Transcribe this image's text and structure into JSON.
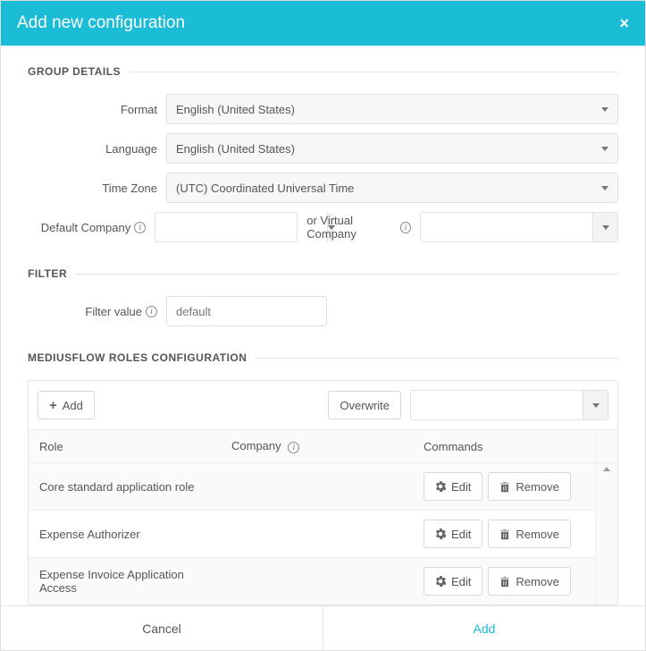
{
  "modal": {
    "title": "Add new configuration"
  },
  "groupDetails": {
    "section": "GROUP DETAILS",
    "formatLabel": "Format",
    "formatValue": "English (United States)",
    "languageLabel": "Language",
    "languageValue": "English (United States)",
    "timeZoneLabel": "Time Zone",
    "timeZoneValue": "(UTC) Coordinated Universal Time",
    "defaultCompanyLabel": "Default Company",
    "orVirtualCompanyLabel": "or Virtual Company"
  },
  "filter": {
    "section": "FILTER",
    "label": "Filter value",
    "placeholder": "default",
    "value": ""
  },
  "roles": {
    "section": "MEDIUSFLOW ROLES CONFIGURATION",
    "addLabel": "Add",
    "overwriteLabel": "Overwrite",
    "columns": {
      "role": "Role",
      "company": "Company",
      "commands": "Commands"
    },
    "editLabel": "Edit",
    "removeLabel": "Remove",
    "rows": [
      {
        "role": "Core standard application role",
        "company": ""
      },
      {
        "role": "Expense Authorizer",
        "company": ""
      },
      {
        "role": "Expense Invoice Application Access",
        "company": ""
      }
    ]
  },
  "footer": {
    "cancel": "Cancel",
    "add": "Add"
  }
}
